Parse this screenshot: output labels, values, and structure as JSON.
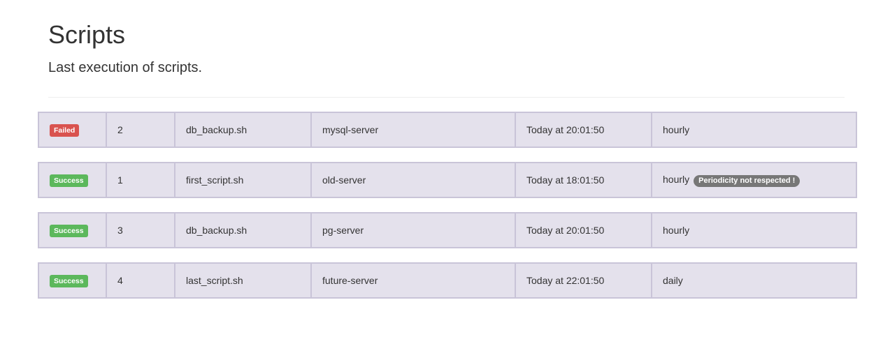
{
  "header": {
    "title": "Scripts",
    "subtitle": "Last execution of scripts."
  },
  "colors": {
    "failed": "#d9534f",
    "success": "#5cb85c",
    "badge": "#777777"
  },
  "rows": [
    {
      "status": "Failed",
      "status_color": "#d9534f",
      "id": "2",
      "script": "db_backup.sh",
      "server": "mysql-server",
      "time": "Today at 20:01:50",
      "periodicity": "hourly",
      "warning": null
    },
    {
      "status": "Success",
      "status_color": "#5cb85c",
      "id": "1",
      "script": "first_script.sh",
      "server": "old-server",
      "time": "Today at 18:01:50",
      "periodicity": "hourly",
      "warning": "Periodicity not respected !"
    },
    {
      "status": "Success",
      "status_color": "#5cb85c",
      "id": "3",
      "script": "db_backup.sh",
      "server": "pg-server",
      "time": "Today at 20:01:50",
      "periodicity": "hourly",
      "warning": null
    },
    {
      "status": "Success",
      "status_color": "#5cb85c",
      "id": "4",
      "script": "last_script.sh",
      "server": "future-server",
      "time": "Today at 22:01:50",
      "periodicity": "daily",
      "warning": null
    }
  ]
}
